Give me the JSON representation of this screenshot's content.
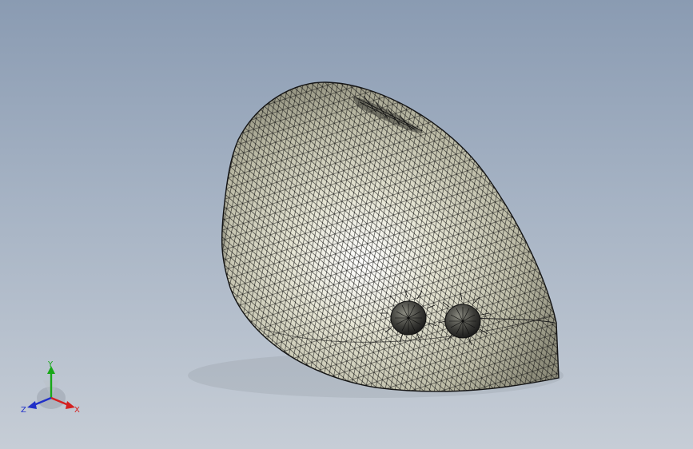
{
  "viewport": {
    "background_top": "#8a9bb2",
    "background_bottom": "#c6cdd6"
  },
  "model": {
    "shell_color": "#d9d8c6",
    "mesh_color": "#1a1a1a",
    "knob_color": "#3a3a3a"
  },
  "triad": {
    "x_label": "X",
    "y_label": "Y",
    "z_label": "Z",
    "x_color": "#d42020",
    "y_color": "#18a818",
    "z_color": "#2030c8"
  }
}
